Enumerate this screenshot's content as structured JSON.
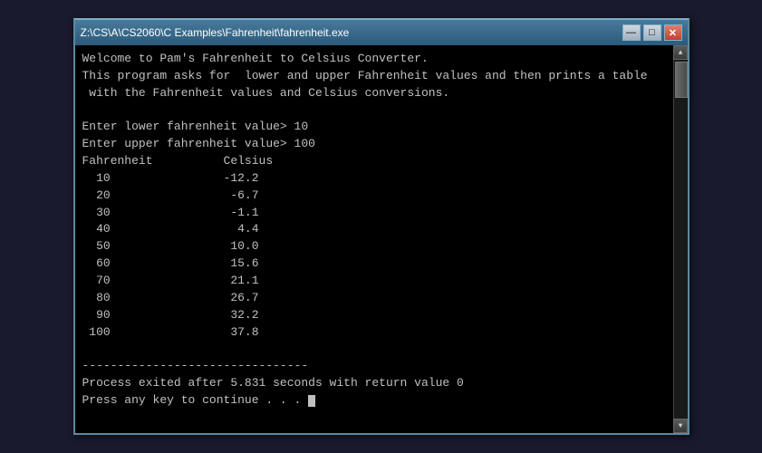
{
  "window": {
    "title": "Z:\\CS\\A\\CS2060\\C Examples\\Fahrenheit\\fahrenheit.exe",
    "minimize_label": "0",
    "maximize_label": "1",
    "close_label": "r"
  },
  "console": {
    "lines": [
      "Welcome to Pam's Fahrenheit to Celsius Converter.",
      "This program asks for  lower and upper Fahrenheit values and then prints a table",
      " with the Fahrenheit values and Celsius conversions.",
      "",
      "Enter lower fahrenheit value> 10",
      "Enter upper fahrenheit value> 100",
      "Fahrenheit          Celsius",
      "  10                -12.2",
      "  20                 -6.7",
      "  30                 -1.1",
      "  40                  4.4",
      "  50                 10.0",
      "  60                 15.6",
      "  70                 21.1",
      "  80                 26.7",
      "  90                 32.2",
      " 100                 37.8",
      "",
      "--------------------------------",
      "Process exited after 5.831 seconds with return value 0",
      "Press any key to continue . . . "
    ]
  }
}
